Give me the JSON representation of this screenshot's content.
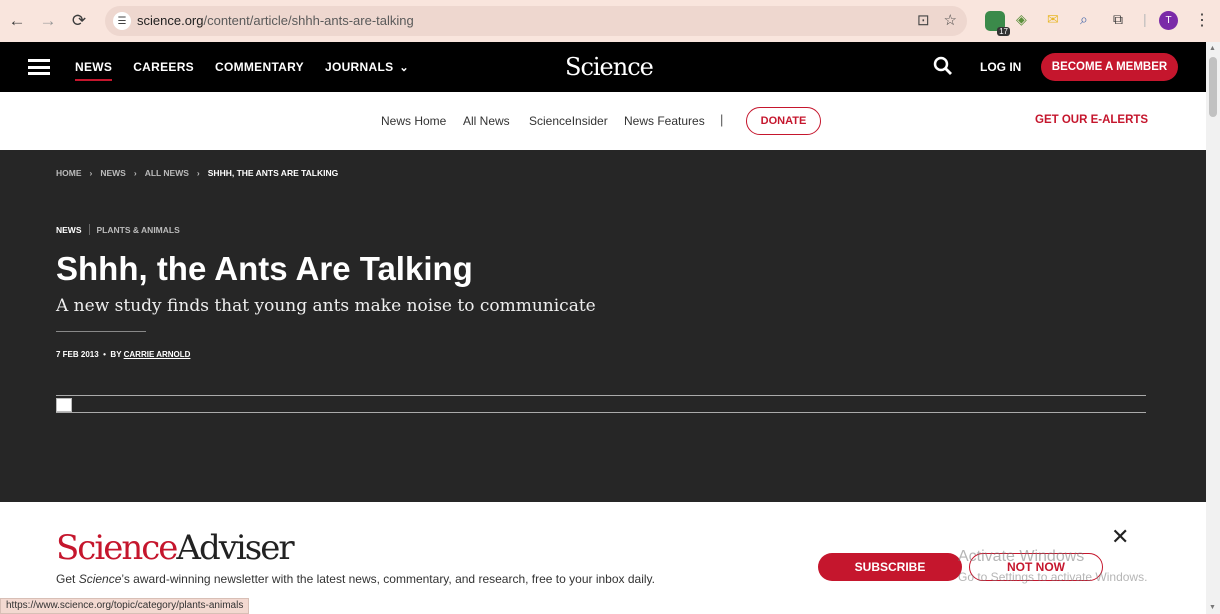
{
  "browser": {
    "url_host": "science.org",
    "url_path": "/content/article/shhh-ants-are-talking",
    "back": "←",
    "forward": "→",
    "reload": "⟳",
    "extension_badge": "17",
    "avatar_letter": "T",
    "icons": [
      "site-settings-icon",
      "install-icon",
      "bookmark-star-icon",
      "extensions-icon",
      "menu-kebab-icon"
    ]
  },
  "header": {
    "nav": [
      {
        "label": "NEWS",
        "active": true
      },
      {
        "label": "CAREERS"
      },
      {
        "label": "COMMENTARY"
      },
      {
        "label": "JOURNALS",
        "dropdown": true
      }
    ],
    "logo": "Science",
    "login": "LOG IN",
    "member": "BECOME A MEMBER"
  },
  "subnav": {
    "links": [
      "News Home",
      "All News",
      "ScienceInsider",
      "News Features"
    ],
    "separator": "|",
    "donate": "DONATE",
    "alerts": "GET OUR E-ALERTS"
  },
  "article": {
    "breadcrumbs": [
      "HOME",
      "NEWS",
      "ALL NEWS",
      "SHHH, THE ANTS ARE TALKING"
    ],
    "kicker_section": "NEWS",
    "kicker_category": "PLANTS & ANIMALS",
    "headline": "Shhh, the Ants Are Talking",
    "dek": "A new study finds that young ants make noise to communicate",
    "date": "7 FEB 2013",
    "by": "BY",
    "author": "CARRIE ARNOLD"
  },
  "newsletter": {
    "brand_a": "Science",
    "brand_b": "Adviser",
    "blurb_pre": "Get ",
    "blurb_em": "Science",
    "blurb_post": "’s award-winning newsletter with the latest news, commentary, and research, free to your inbox daily.",
    "subscribe": "SUBSCRIBE",
    "not_now": "NOT NOW"
  },
  "os_watermark": {
    "line1": "Activate Windows",
    "line2": "Go to Settings to activate Windows."
  },
  "status_url": "https://www.science.org/topic/category/plants-animals",
  "colors": {
    "brand_red": "#c5162d",
    "header_bg": "#000000",
    "hero_bg": "#262626"
  }
}
